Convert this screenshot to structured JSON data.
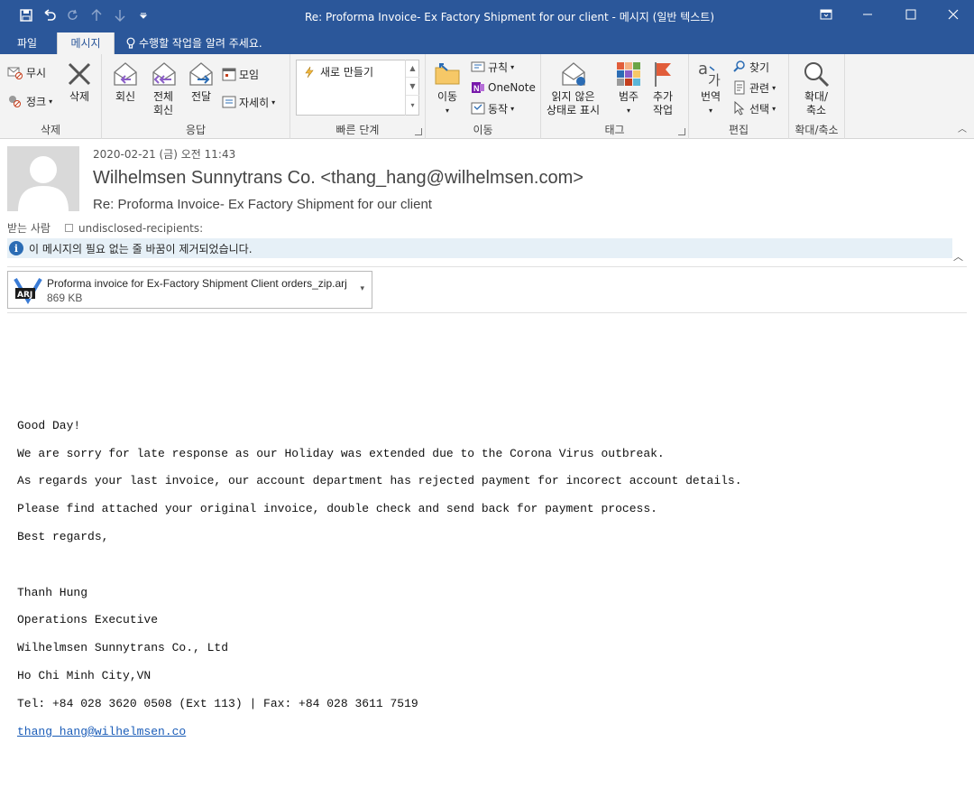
{
  "window": {
    "title": "Re: Proforma Invoice- Ex Factory Shipment for our client - 메시지 (일반 텍스트)"
  },
  "tabs": [
    {
      "label": "파일"
    },
    {
      "label": "메시지"
    }
  ],
  "tell_me": "수행할 작업을 알려 주세요.",
  "ribbon": {
    "delete_group": {
      "label": "삭제",
      "ignore": "무시",
      "cleanup": "정크",
      "delete": "삭제"
    },
    "respond_group": {
      "label": "응답",
      "reply": "회신",
      "reply_all_1": "전체",
      "reply_all_2": "회신",
      "forward": "전달",
      "meeting": "모임",
      "more": "자세히"
    },
    "quick_steps": {
      "label": "빠른 단계",
      "new": "새로 만들기"
    },
    "move_group": {
      "label": "이동",
      "move": "이동",
      "rules": "규칙",
      "onenote": "OneNote",
      "actions": "동작"
    },
    "tags_group": {
      "label": "태그",
      "mark_unread_1": "읽지 않은",
      "mark_unread_2": "상태로 표시",
      "categorize": "범주",
      "followup_1": "추가",
      "followup_2": "작업"
    },
    "editing_group": {
      "label": "편집",
      "translate": "번역",
      "find": "찾기",
      "related": "관련",
      "select": "선택"
    },
    "zoom_group": {
      "label": "확대/축소",
      "zoom_1": "확대/",
      "zoom_2": "축소"
    }
  },
  "message": {
    "date": "2020-02-21 (금) 오전 11:43",
    "sender": "Wilhelmsen Sunnytrans Co. <thang_hang@wilhelmsen.com>",
    "subject": "Re: Proforma Invoice- Ex Factory Shipment for our client",
    "to_label": "받는 사람",
    "to_value": "undisclosed-recipients:",
    "info": "이 메시지의 필요 없는 줄 바꿈이 제거되었습니다."
  },
  "attachment": {
    "name": "Proforma invoice for Ex-Factory Shipment Client orders_zip.arj",
    "size": "869 KB",
    "icon_text": "ARJ"
  },
  "body": {
    "greeting": "Good Day!",
    "p1": "We are sorry for late response as our Holiday was extended due to the Corona Virus outbreak.",
    "p2": "As regards your last invoice, our account department has rejected payment for incorect account details.",
    "p3": "Please find attached your original invoice, double check and send back for payment process.",
    "closing": "Best regards,",
    "sig_name": "Thanh Hung",
    "sig_title": "Operations Executive",
    "sig_company": "Wilhelmsen Sunnytrans Co., Ltd",
    "sig_city": "Ho Chi Minh City,VN",
    "sig_phone": "Tel: +84 028 3620 0508 (Ext 113) | Fax: +84 028 3611 7519",
    "sig_email": "thang_hang@wilhelmsen.co"
  }
}
